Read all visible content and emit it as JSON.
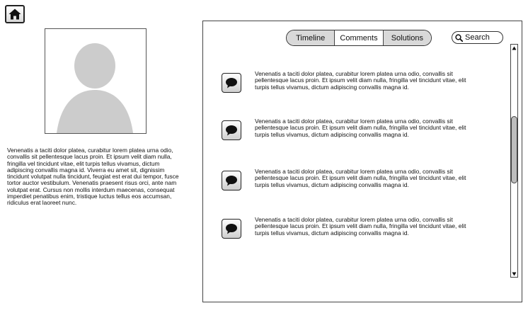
{
  "nav": {
    "home_icon": "home-icon"
  },
  "profile": {
    "avatar_icon": "user-silhouette-icon",
    "bio": "Venenatis a taciti dolor platea, curabitur lorem platea urna odio, convallis sit pellentesque lacus proin. Et ipsum velit diam nulla, fringilla vel tincidunt vitae, elit turpis tellus vivamus, dictum adipiscing convallis magna id. Viverra eu amet sit, dignissim tincidunt volutpat nulla tincidunt, feugiat est erat dui tempor, fusce tortor auctor vestibulum. Venenatis praesent risus orci, ante nam volutpat erat. Cursus non mollis interdum maecenas, consequat imperdiet penatibus enim, tristique luctus tellus eos accumsan, ridiculus erat laoreet nunc."
  },
  "tabs": [
    {
      "label": "Timeline",
      "active": true
    },
    {
      "label": "Comments",
      "active": false
    },
    {
      "label": "Solutions",
      "active": true
    }
  ],
  "search": {
    "label": "Search",
    "icon": "search-icon"
  },
  "comments": [
    {
      "icon": "speech-bubble-icon",
      "text": "Venenatis a taciti dolor platea, curabitur lorem platea urna odio, convallis sit pellentesque lacus proin. Et ipsum velit diam nulla, fringilla vel tincidunt vitae, elit turpis tellus vivamus, dictum adipiscing convallis magna id."
    },
    {
      "icon": "speech-bubble-icon",
      "text": "Venenatis a taciti dolor platea, curabitur lorem platea urna odio, convallis sit pellentesque lacus proin. Et ipsum velit diam nulla, fringilla vel tincidunt vitae, elit turpis tellus vivamus, dictum adipiscing convallis magna id."
    },
    {
      "icon": "speech-bubble-icon",
      "text": "Venenatis a taciti dolor platea, curabitur lorem platea urna odio, convallis sit pellentesque lacus proin. Et ipsum velit diam nulla, fringilla vel tincidunt vitae, elit turpis tellus vivamus, dictum adipiscing convallis magna id."
    },
    {
      "icon": "speech-bubble-icon",
      "text": "Venenatis a taciti dolor platea, curabitur lorem platea urna odio, convallis sit pellentesque lacus proin. Et ipsum velit diam nulla, fringilla vel tincidunt vitae, elit turpis tellus vivamus, dictum adipiscing convallis magna id."
    }
  ],
  "colors": {
    "active_tab": "#d9d9d9",
    "scroll_thumb": "#bdbdbd",
    "avatar_silhouette": "#cccccc"
  }
}
